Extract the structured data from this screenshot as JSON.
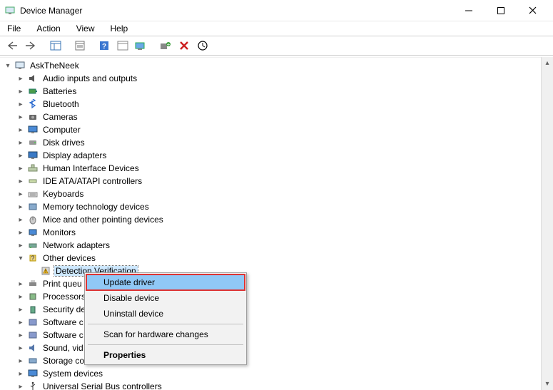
{
  "window": {
    "title": "Device Manager"
  },
  "menubar": {
    "file": "File",
    "action": "Action",
    "view": "View",
    "help": "Help"
  },
  "tree": {
    "root": "AskTheNeek",
    "items": [
      "Audio inputs and outputs",
      "Batteries",
      "Bluetooth",
      "Cameras",
      "Computer",
      "Disk drives",
      "Display adapters",
      "Human Interface Devices",
      "IDE ATA/ATAPI controllers",
      "Keyboards",
      "Memory technology devices",
      "Mice and other pointing devices",
      "Monitors",
      "Network adapters",
      "Other devices",
      "Print queu",
      "Processors",
      "Security de",
      "Software c",
      "Software c",
      "Sound, vid",
      "Storage co",
      "System devices",
      "Universal Serial Bus controllers"
    ],
    "other_child": "Detection Verification"
  },
  "context_menu": {
    "update": "Update driver",
    "disable": "Disable device",
    "uninstall": "Uninstall device",
    "scan": "Scan for hardware changes",
    "properties": "Properties"
  }
}
